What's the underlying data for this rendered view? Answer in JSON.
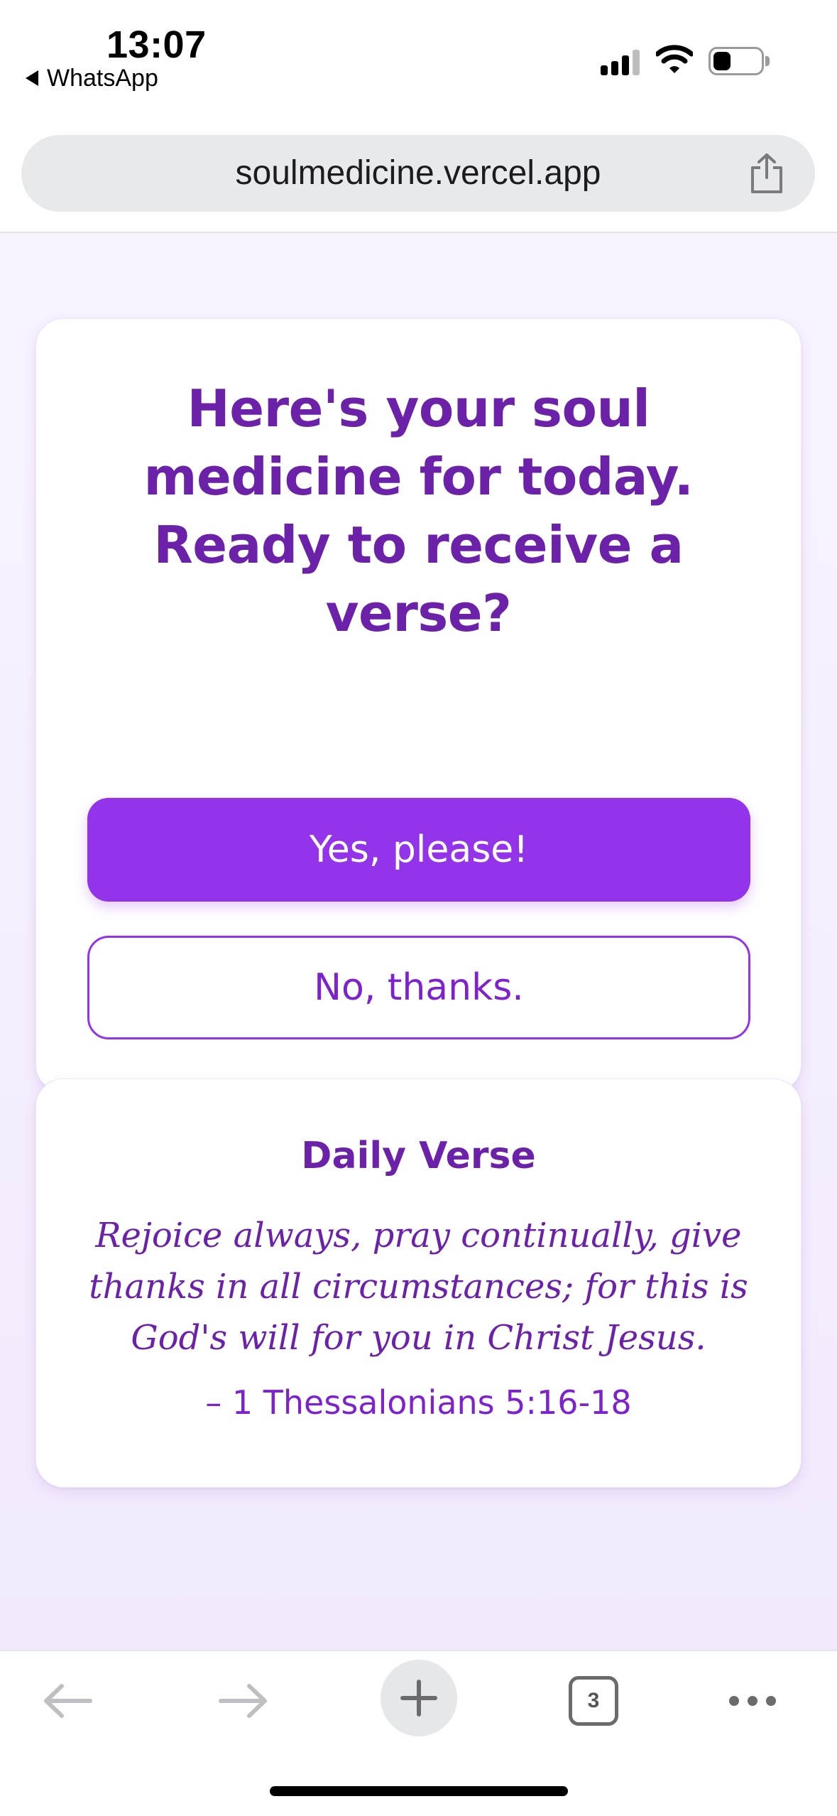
{
  "status_bar": {
    "time": "13:07",
    "back_app_label": "WhatsApp",
    "icons": [
      "signal-icon",
      "wifi-icon",
      "battery-icon"
    ]
  },
  "browser": {
    "url": "soulmedicine.vercel.app",
    "share_icon": "share-icon"
  },
  "prompt_card": {
    "heading": "Here's your soul medicine for today. Ready to receive a verse?",
    "yes_label": "Yes, please!",
    "no_label": "No, thanks."
  },
  "verse_card": {
    "title": "Daily Verse",
    "text": "Rejoice always, pray continually, give thanks in all circumstances; for this is God's will for you in Christ Jesus.",
    "reference": "– 1 Thessalonians 5:16-18"
  },
  "toolbar": {
    "tabs_count": "3",
    "icons": [
      "back-arrow-icon",
      "forward-arrow-icon",
      "plus-icon",
      "tabs-icon",
      "more-icon"
    ]
  },
  "colors": {
    "primary": "#9333ea",
    "heading": "#6b21a8",
    "page_background": "#f5eefd"
  }
}
